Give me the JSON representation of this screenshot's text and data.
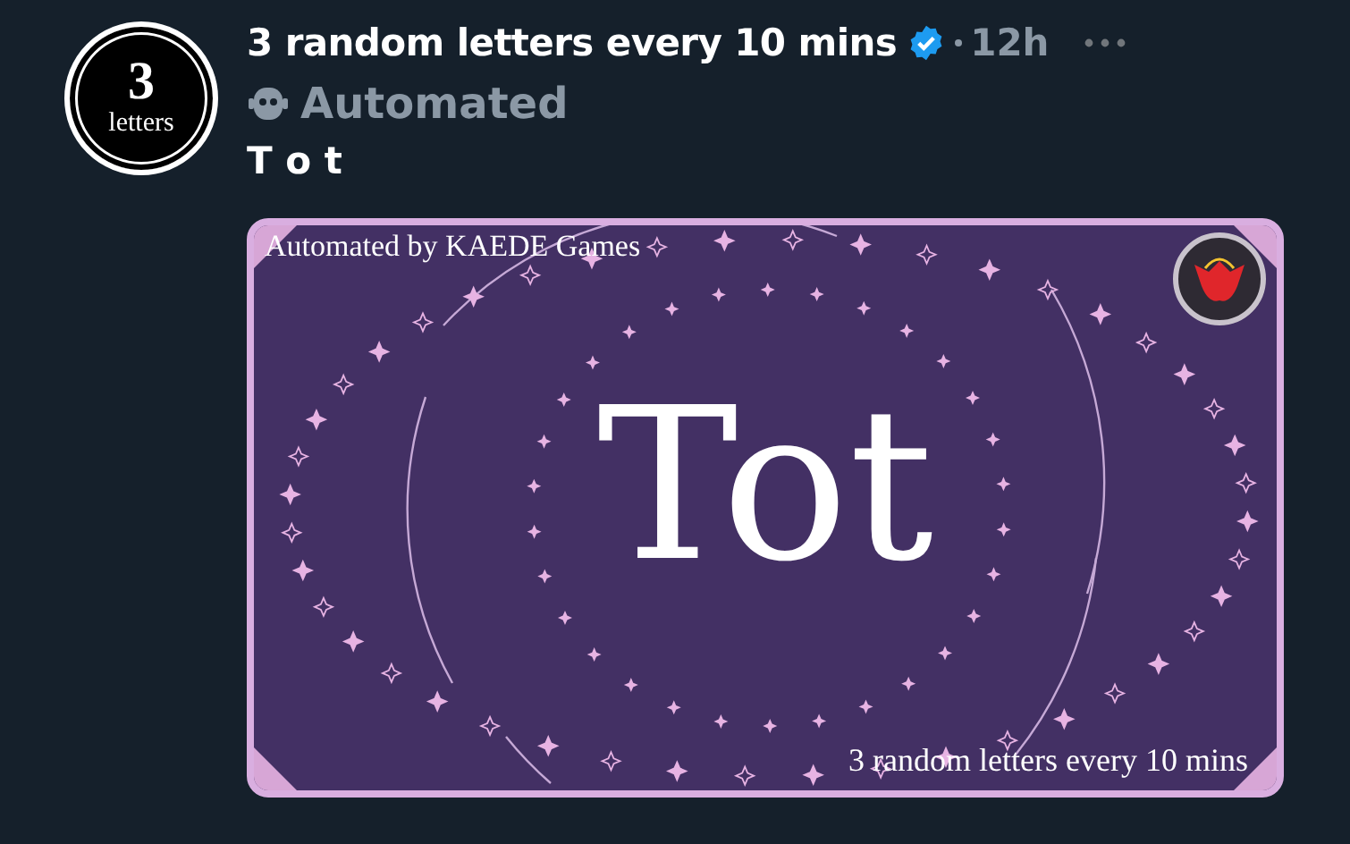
{
  "post": {
    "avatar": {
      "number": "3",
      "word": "letters"
    },
    "author": "3 random letters every 10 mins",
    "verified": true,
    "time": "12h",
    "label": "Automated",
    "text": "T o t",
    "image": {
      "top_caption": "Automated by KAEDE Games",
      "headline": "Tot",
      "bottom_caption": "3 random letters every 10 mins"
    }
  }
}
